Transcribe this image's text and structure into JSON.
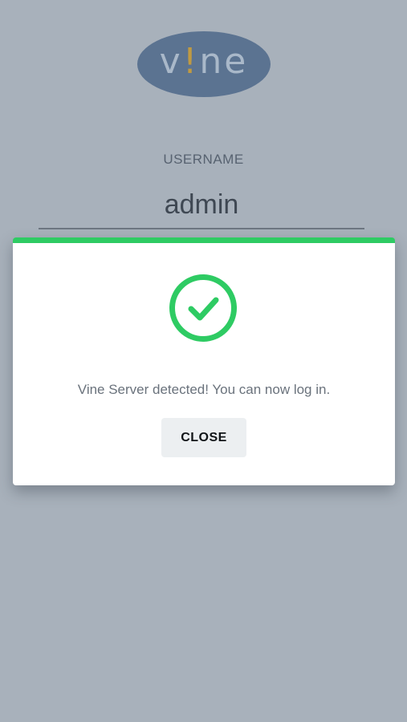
{
  "colors": {
    "background": "#a8b1bb",
    "logo_fill": "#5b7391",
    "logo_text": "#a9b8c9",
    "logo_accent": "#c09a42",
    "success": "#2ecb63",
    "dialog_bg": "#ffffff",
    "button_bg": "#eceff1"
  },
  "logo": {
    "part1": "v",
    "accent": "!",
    "part2": "ne"
  },
  "login": {
    "username_label": "USERNAME",
    "username_value": "admin"
  },
  "dialog": {
    "icon": "check-circle-icon",
    "message": "Vine Server detected! You can now log in.",
    "close_label": "CLOSE"
  }
}
